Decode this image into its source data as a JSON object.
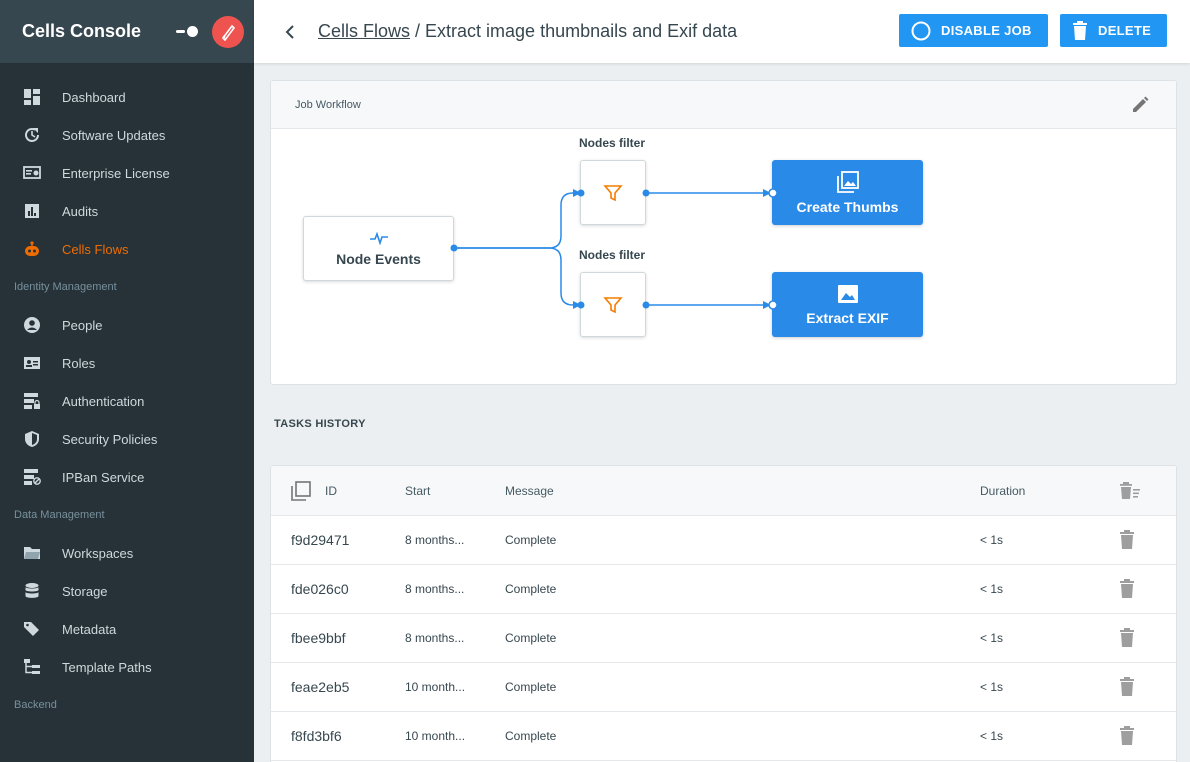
{
  "sidebar": {
    "title": "Cells Console",
    "items": [
      {
        "label": "Dashboard",
        "icon": "dashboard-icon",
        "active": false
      },
      {
        "label": "Software Updates",
        "icon": "update-icon",
        "active": false
      },
      {
        "label": "Enterprise License",
        "icon": "license-icon",
        "active": false
      },
      {
        "label": "Audits",
        "icon": "chart-icon",
        "active": false
      },
      {
        "label": "Cells Flows",
        "icon": "robot-icon",
        "active": true
      }
    ],
    "sections": [
      {
        "title": "Identity Management",
        "items": [
          {
            "label": "People",
            "icon": "person-icon"
          },
          {
            "label": "Roles",
            "icon": "badge-icon"
          },
          {
            "label": "Authentication",
            "icon": "server-lock-icon"
          },
          {
            "label": "Security Policies",
            "icon": "shield-icon"
          },
          {
            "label": "IPBan Service",
            "icon": "server-ban-icon"
          }
        ]
      },
      {
        "title": "Data Management",
        "items": [
          {
            "label": "Workspaces",
            "icon": "folder-icon"
          },
          {
            "label": "Storage",
            "icon": "database-icon"
          },
          {
            "label": "Metadata",
            "icon": "tags-icon"
          },
          {
            "label": "Template Paths",
            "icon": "file-tree-icon"
          }
        ]
      },
      {
        "title": "Backend",
        "items": []
      }
    ]
  },
  "header": {
    "breadcrumb_link": "Cells Flows",
    "breadcrumb_sep": " / ",
    "page_title": "Extract image thumbnails and Exif data",
    "disable_label": "DISABLE JOB",
    "delete_label": "DELETE"
  },
  "workflow": {
    "title": "Job Workflow",
    "trigger_label": "Node Events",
    "filter_label_1": "Nodes filter",
    "filter_label_2": "Nodes filter",
    "action_1": "Create Thumbs",
    "action_2": "Extract EXIF"
  },
  "tasks": {
    "title": "TASKS HISTORY",
    "columns": {
      "id": "ID",
      "start": "Start",
      "message": "Message",
      "duration": "Duration"
    },
    "rows": [
      {
        "id": "f9d29471",
        "start": "8 months...",
        "message": "Complete",
        "duration": "< 1s"
      },
      {
        "id": "fde026c0",
        "start": "8 months...",
        "message": "Complete",
        "duration": "< 1s"
      },
      {
        "id": "fbee9bbf",
        "start": "8 months...",
        "message": "Complete",
        "duration": "< 1s"
      },
      {
        "id": "feae2eb5",
        "start": "10 month...",
        "message": "Complete",
        "duration": "< 1s"
      },
      {
        "id": "f8fd3bf6",
        "start": "10 month...",
        "message": "Complete",
        "duration": "< 1s"
      }
    ]
  },
  "colors": {
    "accent": "#2196f3",
    "active": "#ef6c00",
    "sidebar_bg": "#263238"
  }
}
